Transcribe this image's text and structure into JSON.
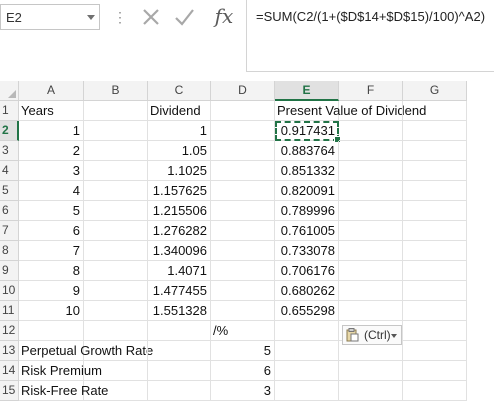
{
  "name_box": {
    "value": "E2"
  },
  "formula_bar": {
    "dots": "⋮",
    "formula": "=SUM(C2/(1+($D$14+$D$15)/100)^A2)",
    "fx_label": "fx"
  },
  "columns": [
    "A",
    "B",
    "C",
    "D",
    "E",
    "F",
    "G"
  ],
  "selected_column": "E",
  "selected_row": "2",
  "rows": [
    {
      "num": "1",
      "A": "Years",
      "B": "",
      "C": "Dividend",
      "D": "",
      "E": "Present Value of Dividend",
      "F": "",
      "G": ""
    },
    {
      "num": "2",
      "A": "1",
      "B": "",
      "C": "1",
      "D": "",
      "E": "0.917431",
      "F": "",
      "G": ""
    },
    {
      "num": "3",
      "A": "2",
      "B": "",
      "C": "1.05",
      "D": "",
      "E": "0.883764",
      "F": "",
      "G": ""
    },
    {
      "num": "4",
      "A": "3",
      "B": "",
      "C": "1.1025",
      "D": "",
      "E": "0.851332",
      "F": "",
      "G": ""
    },
    {
      "num": "5",
      "A": "4",
      "B": "",
      "C": "1.157625",
      "D": "",
      "E": "0.820091",
      "F": "",
      "G": ""
    },
    {
      "num": "6",
      "A": "5",
      "B": "",
      "C": "1.215506",
      "D": "",
      "E": "0.789996",
      "F": "",
      "G": ""
    },
    {
      "num": "7",
      "A": "6",
      "B": "",
      "C": "1.276282",
      "D": "",
      "E": "0.761005",
      "F": "",
      "G": ""
    },
    {
      "num": "8",
      "A": "7",
      "B": "",
      "C": "1.340096",
      "D": "",
      "E": "0.733078",
      "F": "",
      "G": ""
    },
    {
      "num": "9",
      "A": "8",
      "B": "",
      "C": "1.4071",
      "D": "",
      "E": "0.706176",
      "F": "",
      "G": ""
    },
    {
      "num": "10",
      "A": "9",
      "B": "",
      "C": "1.477455",
      "D": "",
      "E": "0.680262",
      "F": "",
      "G": ""
    },
    {
      "num": "11",
      "A": "10",
      "B": "",
      "C": "1.551328",
      "D": "",
      "E": "0.655298",
      "F": "",
      "G": ""
    },
    {
      "num": "12",
      "A": "",
      "B": "",
      "C": "",
      "D": "/%",
      "E": "",
      "F": "",
      "G": ""
    },
    {
      "num": "13",
      "A": "Perpetual Growth Rate",
      "B": "",
      "C": "",
      "D": "5",
      "E": "",
      "F": "",
      "G": ""
    },
    {
      "num": "14",
      "A": "Risk Premium",
      "B": "",
      "C": "",
      "D": "6",
      "E": "",
      "F": "",
      "G": ""
    },
    {
      "num": "15",
      "A": "Risk-Free Rate",
      "B": "",
      "C": "",
      "D": "3",
      "E": "",
      "F": "",
      "G": ""
    }
  ],
  "paste_options": {
    "label": "(Ctrl)"
  },
  "colors": {
    "accent": "#217346",
    "header_bg": "#f3f3f3",
    "gridline": "#e1e1e1"
  }
}
